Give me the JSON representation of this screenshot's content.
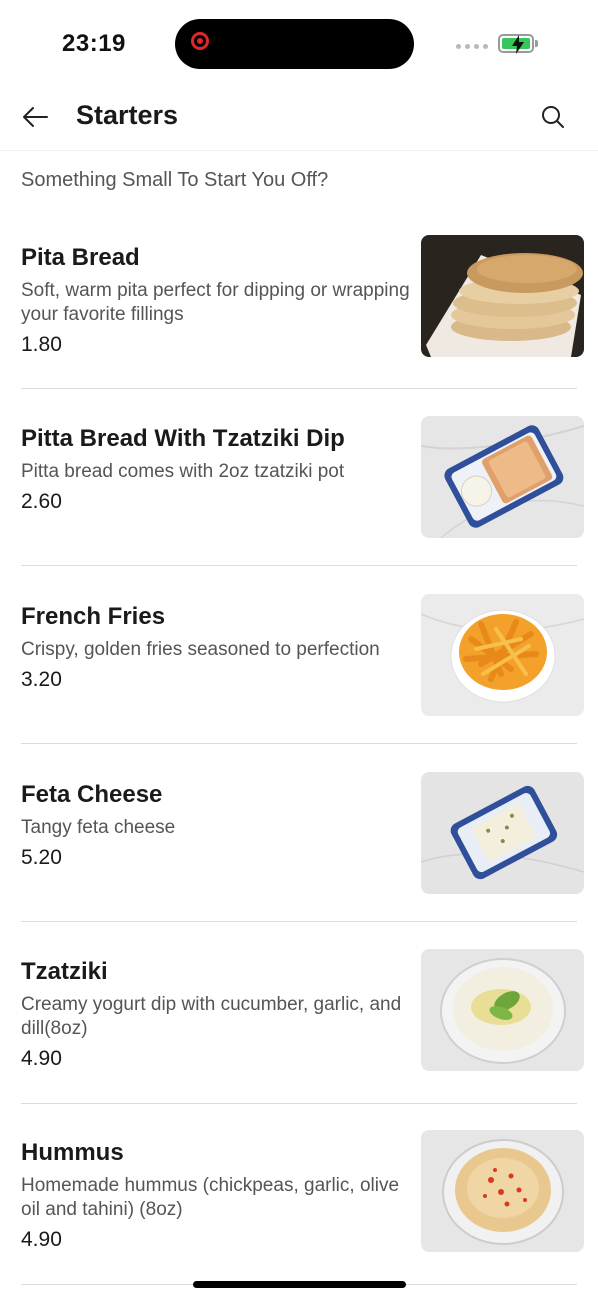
{
  "status_bar": {
    "time": "23:19"
  },
  "header": {
    "title": "Starters",
    "back_icon": "arrow-left-icon",
    "search_icon": "search-icon"
  },
  "subtitle": "Something Small To Start You Off?",
  "items": [
    {
      "name": "Pita Bread",
      "description": "Soft, warm pita perfect for dipping or wrapping your favorite fillings",
      "price": "1.80",
      "image": "pita-bread-photo"
    },
    {
      "name": "Pitta Bread With Tzatziki Dip",
      "description": "Pitta bread comes with 2oz tzatziki pot",
      "price": "2.60",
      "image": "pitta-tzatziki-photo"
    },
    {
      "name": "French Fries",
      "description": "Crispy, golden fries seasoned to perfection",
      "price": "3.20",
      "image": "french-fries-photo"
    },
    {
      "name": "Feta Cheese",
      "description": "Tangy feta cheese",
      "price": "5.20",
      "image": "feta-cheese-photo"
    },
    {
      "name": "Tzatziki",
      "description": "Creamy yogurt dip with cucumber, garlic, and dill(8oz)",
      "price": "4.90",
      "image": "tzatziki-photo"
    },
    {
      "name": "Hummus",
      "description": "Homemade hummus (chickpeas, garlic, olive oil and tahini) (8oz)",
      "price": "4.90",
      "image": "hummus-photo"
    }
  ],
  "colors": {
    "text_primary": "#1a1a1a",
    "text_secondary": "#555555",
    "divider": "#dcdcdc",
    "battery": "#34c759",
    "record": "#e0262b"
  }
}
